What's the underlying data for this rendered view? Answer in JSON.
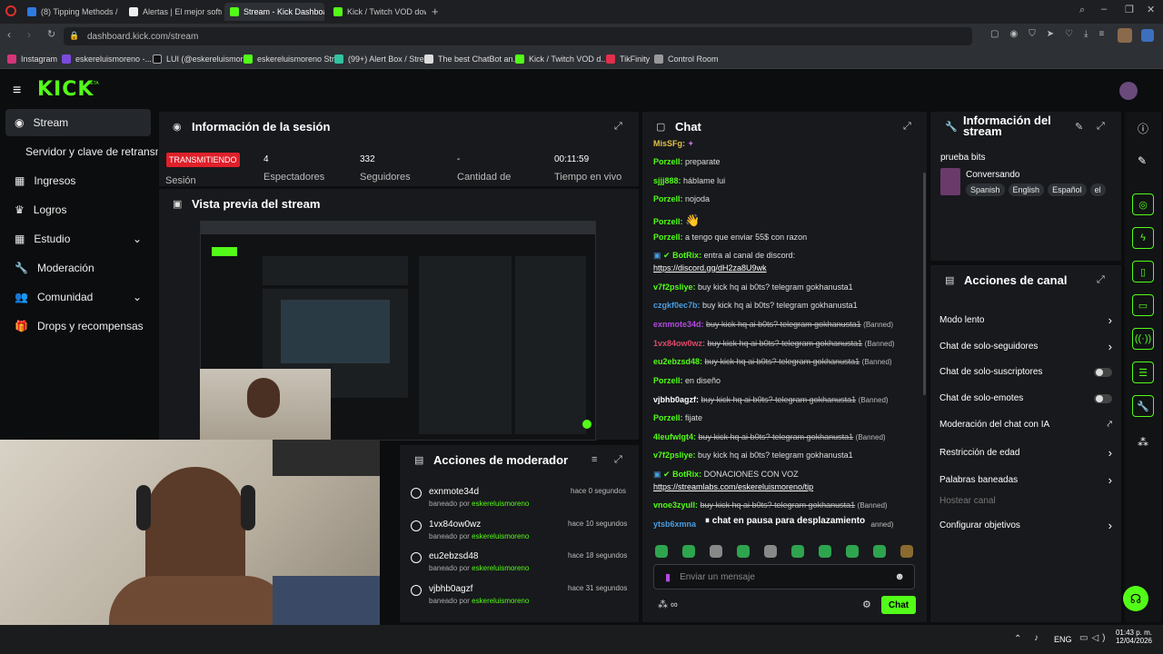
{
  "browser": {
    "tabs": [
      {
        "label": "(8) Tipping Methods / Str",
        "color": "#2d7be0"
      },
      {
        "label": "Alertas | El mejor software",
        "color": "#eee"
      },
      {
        "label": "Stream - Kick Dashboard",
        "color": "#53fc18"
      },
      {
        "label": "Kick / Twitch VOD downlo",
        "color": "#53fc18"
      }
    ],
    "url": "dashboard.kick.com/stream",
    "bookmarks": [
      "Instagram",
      "eskereluismoreno -...",
      "LUI (@eskereluismor...",
      "eskereluismoreno Str...",
      "(99+) Alert Box / Stre...",
      "The best ChatBot an...",
      "Kick / Twitch VOD d...",
      "TikFinity",
      "Control Room"
    ]
  },
  "app": {
    "logo": "KICK",
    "beta": "BETA"
  },
  "sidebar": {
    "items": [
      {
        "label": "Stream",
        "icon": "broadcast-icon"
      },
      {
        "label": "Servidor y clave de retransmisión",
        "icon": ""
      },
      {
        "label": "Ingresos",
        "icon": "chart-icon"
      },
      {
        "label": "Logros",
        "icon": "trophy-icon"
      },
      {
        "label": "Estudio",
        "icon": "grid-icon"
      },
      {
        "label": "Moderación",
        "icon": "wrench-icon"
      },
      {
        "label": "Comunidad",
        "icon": "people-icon"
      },
      {
        "label": "Drops y recompensas",
        "icon": "gift-icon"
      }
    ]
  },
  "session": {
    "title": "Información de la sesión",
    "badge": "TRANSMITIENDO",
    "badge_label": "Sesión",
    "stats": [
      {
        "value": "4",
        "label": "Espectadores"
      },
      {
        "value": "332",
        "label": "Seguidores"
      },
      {
        "value": "-",
        "label": "Cantidad de"
      },
      {
        "value": "00:11:59",
        "label": "Tiempo en vivo"
      }
    ]
  },
  "preview": {
    "title": "Vista previa del stream"
  },
  "modactions": {
    "title": "Acciones de moderador",
    "items": [
      {
        "user": "exnmote34d",
        "by": "baneado por",
        "mod": "eskereluismoreno",
        "time": "hace 0 segundos"
      },
      {
        "user": "1vx84ow0wz",
        "by": "baneado por",
        "mod": "eskereluismoreno",
        "time": "hace 10 segundos"
      },
      {
        "user": "eu2ebzsd48",
        "by": "baneado por",
        "mod": "eskereluismoreno",
        "time": "hace 18 segundos"
      },
      {
        "user": "vjbhb0agzf",
        "by": "baneado por",
        "mod": "eskereluismoreno",
        "time": "hace 31 segundos"
      }
    ]
  },
  "chat": {
    "title": "Chat",
    "messages": [
      {
        "user": "MisSFg:",
        "color": "#e0c04a",
        "text": "",
        "struck": false,
        "banned": ""
      },
      {
        "user": "Porzell:",
        "color": "#53fc18",
        "text": "preparate",
        "struck": false,
        "banned": ""
      },
      {
        "user": "sjjj888:",
        "color": "#53fc18",
        "text": "háblame lui",
        "struck": false,
        "banned": ""
      },
      {
        "user": "Porzell:",
        "color": "#53fc18",
        "text": "nojoda",
        "struck": false,
        "banned": ""
      },
      {
        "user": "Porzell:",
        "color": "#53fc18",
        "text": "👋",
        "struck": false,
        "banned": ""
      },
      {
        "user": "Porzell:",
        "color": "#53fc18",
        "text": "a tengo que enviar 55$ con razon",
        "struck": false,
        "banned": ""
      },
      {
        "user": "BotRix:",
        "color": "#53fc18",
        "text": "entra al canal de discord:",
        "struck": false,
        "banned": ""
      },
      {
        "user": "",
        "color": "#fff",
        "text": "https://discord.gg/dH2za8U9wk",
        "struck": false,
        "banned": ""
      },
      {
        "user": "v7f2psliye:",
        "color": "#53fc18",
        "text": "buy kick hq ai b0ts? telegram gokhanusta1",
        "struck": false,
        "banned": ""
      },
      {
        "user": "czgkf0ec7b:",
        "color": "#4a9de0",
        "text": "buy kick hq ai b0ts? telegram gokhanusta1",
        "struck": false,
        "banned": ""
      },
      {
        "user": "exnmote34d:",
        "color": "#b44ae0",
        "text": "buy kick hq ai b0ts? telegram gokhanusta1",
        "struck": true,
        "banned": "(Banned)"
      },
      {
        "user": "1vx84ow0wz:",
        "color": "#e04a6a",
        "text": "buy kick hq ai b0ts? telegram gokhanusta1",
        "struck": true,
        "banned": "(Banned)"
      },
      {
        "user": "eu2ebzsd48:",
        "color": "#53fc18",
        "text": "buy kick hq ai b0ts? telegram gokhanusta1",
        "struck": true,
        "banned": "(Banned)"
      },
      {
        "user": "Porzell:",
        "color": "#53fc18",
        "text": "en diseño",
        "struck": false,
        "banned": ""
      },
      {
        "user": "vjbhb0agzf:",
        "color": "#fff",
        "text": "buy kick hq ai b0ts? telegram gokhanusta1",
        "struck": true,
        "banned": "(Banned)"
      },
      {
        "user": "Porzell:",
        "color": "#53fc18",
        "text": "fijate",
        "struck": false,
        "banned": ""
      },
      {
        "user": "4leufwlgt4:",
        "color": "#53fc18",
        "text": "buy kick hq ai b0ts? telegram gokhanusta1",
        "struck": true,
        "banned": "(Banned)"
      },
      {
        "user": "v7f2psliye:",
        "color": "#53fc18",
        "text": "buy kick hq ai b0ts? telegram gokhanusta1",
        "struck": false,
        "banned": ""
      },
      {
        "user": "BotRix:",
        "color": "#53fc18",
        "text": "DONACIONES CON VOZ",
        "struck": false,
        "banned": ""
      },
      {
        "user": "",
        "color": "#fff",
        "text": "https://streamlabs.com/eskereluismoreno/tip",
        "struck": false,
        "banned": ""
      },
      {
        "user": "vnoe3zyull:",
        "color": "#53fc18",
        "text": "buy kick hq ai b0ts? telegram gokhanusta1",
        "struck": true,
        "banned": "(Banned)"
      },
      {
        "user": "ytsb6xmna",
        "color": "#4a9de0",
        "text": "",
        "struck": false,
        "banned": "(Banned)"
      }
    ],
    "paused": "chat en pausa para desplazamiento",
    "input_placeholder": "Enviar un mensaje",
    "send_label": "Chat"
  },
  "streaminfo": {
    "title": "Información del stream",
    "stream_title": "prueba bits",
    "category": "Conversando",
    "tags": [
      "Spanish",
      "English",
      "Español",
      "el"
    ]
  },
  "channel": {
    "title": "Acciones de canal",
    "rows": [
      {
        "label": "Modo lento",
        "control": "chevron"
      },
      {
        "label": "Chat de solo-seguidores",
        "control": "chevron"
      },
      {
        "label": "Chat de solo-suscriptores",
        "control": "toggle"
      },
      {
        "label": "Chat de solo-emotes",
        "control": "toggle"
      },
      {
        "label": "Moderación del chat con IA",
        "control": "external"
      },
      {
        "label": "Restricción de edad",
        "control": "chevron"
      },
      {
        "label": "Palabras baneadas",
        "control": "chevron"
      },
      {
        "label": "Hostear canal",
        "control": "disabled"
      },
      {
        "label": "Configurar objetivos",
        "control": "chevron"
      }
    ]
  },
  "taskbar": {
    "lang": "ENG",
    "time": "01:43 p. m.",
    "date": "12/04/2026"
  },
  "colors": {
    "accent": "#53fc18",
    "panel": "#17191c",
    "bg": "#0b0d0e"
  }
}
